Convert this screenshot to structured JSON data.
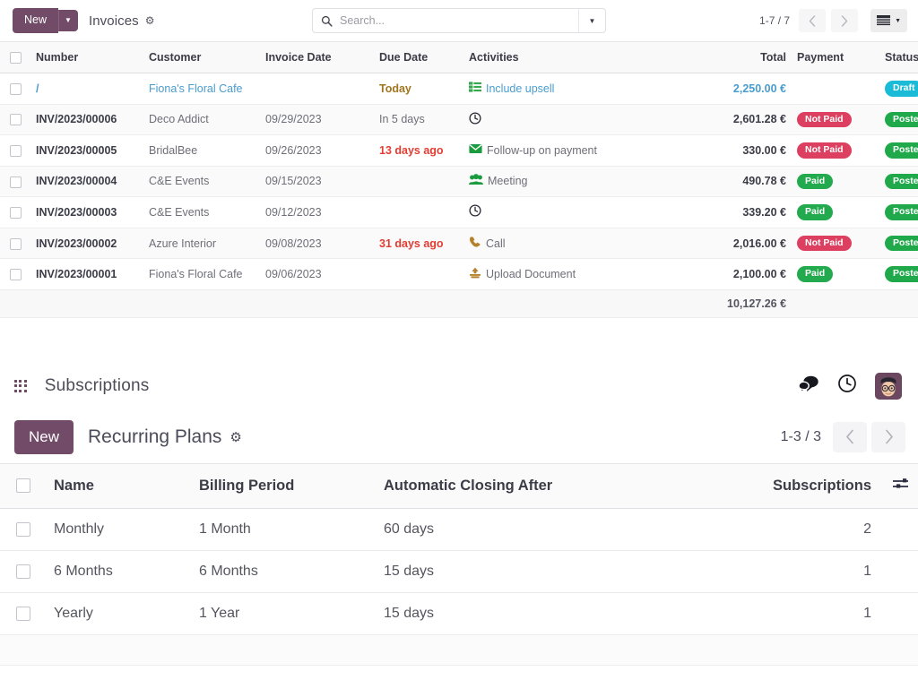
{
  "invoices_panel": {
    "new_button": "New",
    "new_caret_icon": "chevron-down-icon",
    "breadcrumb_title": "Invoices",
    "settings_icon": "gear-icon",
    "search": {
      "icon": "search-icon",
      "value": "",
      "placeholder": "Search...",
      "dropdown_icon": "chevron-down-icon"
    },
    "pager": {
      "range": "1-7 / 7",
      "prev_icon": "chevron-left-icon",
      "next_icon": "chevron-right-icon"
    },
    "view_switcher": {
      "icon": "list-view-icon",
      "caret_icon": "chevron-down-icon"
    }
  },
  "invoices_table": {
    "select_all_icon": "checkbox-icon",
    "optional_columns_icon": "sliders-icon",
    "columns": [
      "Number",
      "Customer",
      "Invoice Date",
      "Due Date",
      "Activities",
      "Total",
      "Payment",
      "Status"
    ],
    "rows": [
      {
        "number": "/",
        "number_style": "draft",
        "customer": "Fiona's Floral Cafe",
        "customer_style": "draft",
        "invoice_date": "",
        "due_date": "Today",
        "due_style": "today",
        "activity_icon": "tasks-icon",
        "activity_icon_color": "#36a84f",
        "activity": "Include upsell",
        "activity_style": "draft",
        "total": "2,250.00 €",
        "total_style": "draft",
        "payment": "",
        "payment_style": "",
        "status": "Draft",
        "status_style": "draft"
      },
      {
        "number": "INV/2023/00006",
        "number_style": "normal",
        "customer": "Deco Addict",
        "customer_style": "normal",
        "invoice_date": "09/29/2023",
        "due_date": "In 5 days",
        "due_style": "normal",
        "activity_icon": "clock-icon",
        "activity_icon_color": "#2b2b36",
        "activity": "",
        "activity_style": "normal",
        "total": "2,601.28 €",
        "total_style": "normal",
        "payment": "Not Paid",
        "payment_style": "notpaid",
        "status": "Posted",
        "status_style": "posted"
      },
      {
        "number": "INV/2023/00005",
        "number_style": "normal",
        "customer": "BridalBee",
        "customer_style": "normal",
        "invoice_date": "09/26/2023",
        "due_date": "13 days ago",
        "due_style": "overdue",
        "activity_icon": "envelope-icon",
        "activity_icon_color": "#1a9b3f",
        "activity": "Follow-up on payment",
        "activity_style": "normal",
        "total": "330.00 €",
        "total_style": "normal",
        "payment": "Not Paid",
        "payment_style": "notpaid",
        "status": "Posted",
        "status_style": "posted"
      },
      {
        "number": "INV/2023/00004",
        "number_style": "normal",
        "customer": "C&E Events",
        "customer_style": "normal",
        "invoice_date": "09/15/2023",
        "due_date": "",
        "due_style": "normal",
        "activity_icon": "users-icon",
        "activity_icon_color": "#1a9b3f",
        "activity": "Meeting",
        "activity_style": "normal",
        "total": "490.78 €",
        "total_style": "normal",
        "payment": "Paid",
        "payment_style": "paid",
        "status": "Posted",
        "status_style": "posted"
      },
      {
        "number": "INV/2023/00003",
        "number_style": "normal",
        "customer": "C&E Events",
        "customer_style": "normal",
        "invoice_date": "09/12/2023",
        "due_date": "",
        "due_style": "normal",
        "activity_icon": "clock-icon",
        "activity_icon_color": "#2b2b36",
        "activity": "",
        "activity_style": "normal",
        "total": "339.20 €",
        "total_style": "normal",
        "payment": "Paid",
        "payment_style": "paid",
        "status": "Posted",
        "status_style": "posted"
      },
      {
        "number": "INV/2023/00002",
        "number_style": "normal",
        "customer": "Azure Interior",
        "customer_style": "normal",
        "invoice_date": "09/08/2023",
        "due_date": "31 days ago",
        "due_style": "overdue",
        "activity_icon": "phone-icon",
        "activity_icon_color": "#b5802a",
        "activity": "Call",
        "activity_style": "normal",
        "total": "2,016.00 €",
        "total_style": "normal",
        "payment": "Not Paid",
        "payment_style": "notpaid",
        "status": "Posted",
        "status_style": "posted"
      },
      {
        "number": "INV/2023/00001",
        "number_style": "normal",
        "customer": "Fiona's Floral Cafe",
        "customer_style": "normal",
        "invoice_date": "09/06/2023",
        "due_date": "",
        "due_style": "normal",
        "activity_icon": "upload-icon",
        "activity_icon_color": "#b5802a",
        "activity": "Upload Document",
        "activity_style": "normal",
        "total": "2,100.00 €",
        "total_style": "normal",
        "payment": "Paid",
        "payment_style": "paid",
        "status": "Posted",
        "status_style": "posted"
      }
    ],
    "total_label": "",
    "grand_total": "10,127.26 €"
  },
  "navbar": {
    "apps_icon": "apps-grid-icon",
    "app_name": "Subscriptions",
    "messages_icon": "chat-bubble-icon",
    "activities_icon": "clock-icon",
    "avatar_icon": "user-avatar"
  },
  "plans_panel": {
    "new_button": "New",
    "breadcrumb_title": "Recurring Plans",
    "settings_icon": "gear-icon",
    "pager": {
      "range": "1-3 / 3",
      "prev_icon": "chevron-left-icon",
      "next_icon": "chevron-right-icon"
    }
  },
  "plans_table": {
    "select_all_icon": "checkbox-icon",
    "optional_columns_icon": "sliders-icon",
    "columns": [
      "Name",
      "Billing Period",
      "Automatic Closing After",
      "Subscriptions"
    ],
    "rows": [
      {
        "name": "Monthly",
        "billing_period": "1 Month",
        "closing_after": "60 days",
        "subscriptions": "2"
      },
      {
        "name": "6 Months",
        "billing_period": "6 Months",
        "closing_after": "15 days",
        "subscriptions": "1"
      },
      {
        "name": "Yearly",
        "billing_period": "1 Year",
        "closing_after": "15 days",
        "subscriptions": "1"
      }
    ]
  },
  "colors": {
    "brand_purple": "#714b67",
    "draft_badge": "#1abbd6",
    "posted_badge": "#1fa94a",
    "paid_badge": "#23a94e",
    "notpaid_badge": "#dc3f5f",
    "overdue_text": "#e23d33",
    "today_text": "#a0761e",
    "link_blue": "#4a9ccd"
  }
}
